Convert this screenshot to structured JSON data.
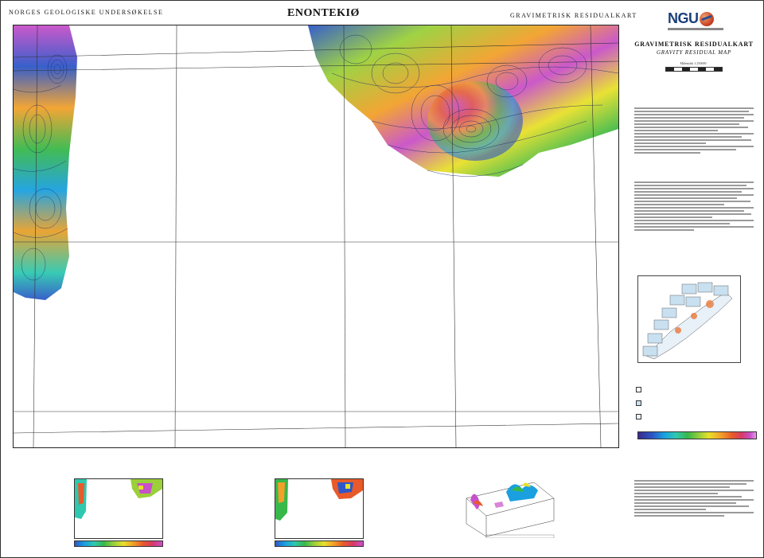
{
  "header": {
    "left": "NORGES GEOLOGISKE UNDERSØKELSE",
    "center": "ENONTEKIØ",
    "right": "GRAVIMETRISK RESIDUALKART"
  },
  "panel": {
    "logo_text": "NGU",
    "title_no": "GRAVIMETRISK RESIDUALKART",
    "title_en": "GRAVITY RESIDUAL MAP",
    "scale_text": "Målestokk 1:250000"
  },
  "colors": {
    "contour": "#1b2a6b",
    "low": "#2d57c8",
    "high": "#d83a6a"
  },
  "icons": [
    "ngu-globe-icon",
    "legend-swatch-icon"
  ]
}
